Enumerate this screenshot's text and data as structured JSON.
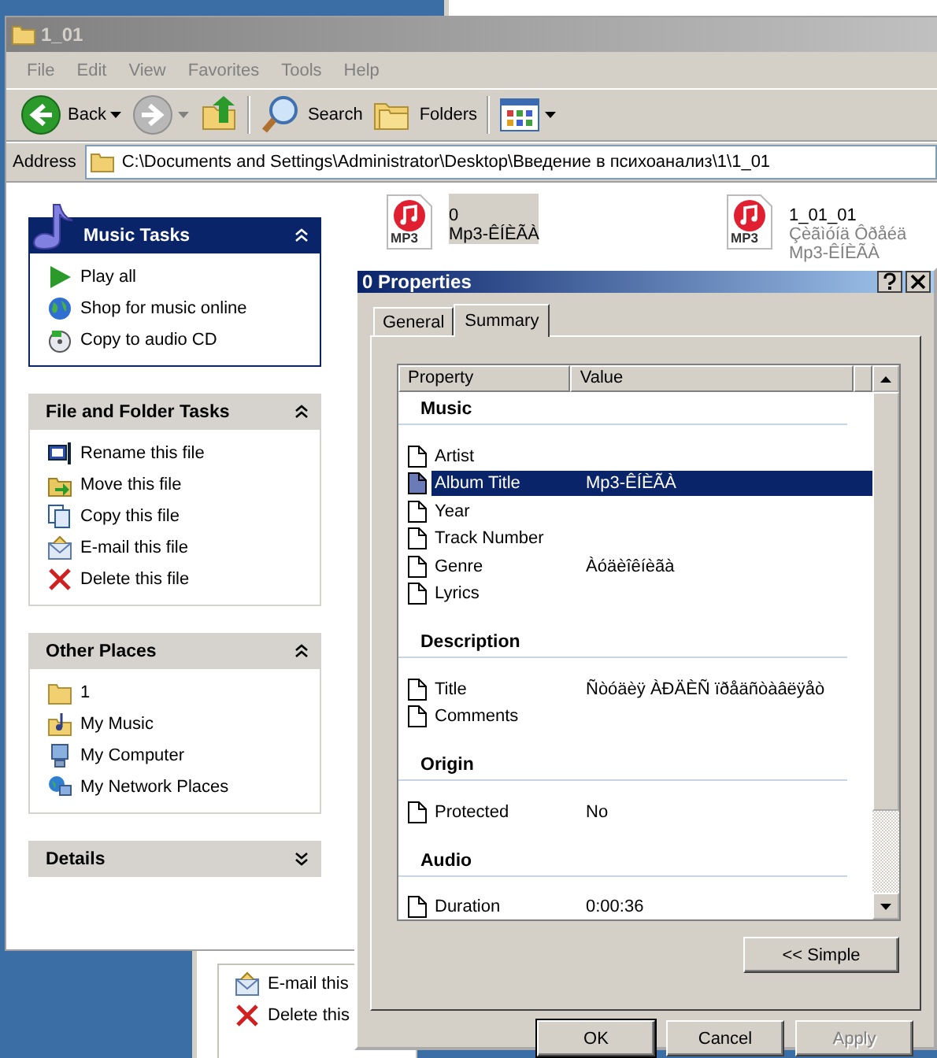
{
  "explorer": {
    "title": "1_01",
    "menu": [
      "File",
      "Edit",
      "View",
      "Favorites",
      "Tools",
      "Help"
    ],
    "toolbar": [
      {
        "kind": "back",
        "label": "Back",
        "dropdown": true
      },
      {
        "kind": "forward",
        "dropdown": true
      },
      {
        "kind": "up"
      },
      {
        "kind": "search",
        "label": "Search"
      },
      {
        "kind": "folders",
        "label": "Folders"
      },
      {
        "kind": "views",
        "dropdown": true
      }
    ],
    "address": {
      "label": "Address",
      "value": "C:\\Documents and Settings\\Administrator\\Desktop\\Введение в психоанализ\\1\\1_01"
    },
    "task_panes": [
      {
        "title": "Music Tasks",
        "kind": "special",
        "expanded": true,
        "items": [
          {
            "kind": "play",
            "label": "Play all"
          },
          {
            "kind": "globe",
            "label": "Shop for music online"
          },
          {
            "kind": "disc",
            "label": "Copy to audio CD"
          }
        ]
      },
      {
        "title": "File and Folder Tasks",
        "kind": "normal",
        "expanded": true,
        "items": [
          {
            "kind": "rename",
            "label": "Rename this file"
          },
          {
            "kind": "move",
            "label": "Move this file"
          },
          {
            "kind": "copy",
            "label": "Copy this file"
          },
          {
            "kind": "email",
            "label": "E-mail this file"
          },
          {
            "kind": "delete",
            "label": "Delete this file"
          }
        ]
      },
      {
        "title": "Other Places",
        "kind": "normal",
        "expanded": true,
        "items": [
          {
            "kind": "folder",
            "label": "1"
          },
          {
            "kind": "music-folder",
            "label": "My Music"
          },
          {
            "kind": "computer",
            "label": "My Computer"
          },
          {
            "kind": "network",
            "label": "My Network Places"
          }
        ]
      },
      {
        "title": "Details",
        "kind": "normal",
        "expanded": false
      }
    ],
    "files": [
      {
        "icon_label": "MP3",
        "name": "0",
        "details": [
          "Mp3-ÊÍÈÃÀ"
        ],
        "selected": true
      },
      {
        "icon_label": "MP3",
        "name": "1_01_01",
        "details": [
          "Çèãìóíä Ôðåéä",
          "Mp3-ÊÍÈÃÀ"
        ],
        "selected": false
      }
    ]
  },
  "dialog": {
    "title": "0 Properties",
    "tabs": [
      {
        "label": "General",
        "selected": false
      },
      {
        "label": "Summary",
        "selected": true
      }
    ],
    "columns": [
      "Property",
      "Value"
    ],
    "rows": [
      {
        "kind": "section",
        "label": "Music"
      },
      {
        "kind": "property",
        "label": "Artist",
        "selected": false
      },
      {
        "kind": "property",
        "label": "Album Title",
        "value": "Mp3-ÊÍÈÃÀ",
        "selected": true
      },
      {
        "kind": "property",
        "label": "Year",
        "selected": false
      },
      {
        "kind": "property",
        "label": "Track Number",
        "selected": false
      },
      {
        "kind": "property",
        "label": "Genre",
        "value": "Àóäèîêíèãà",
        "selected": false
      },
      {
        "kind": "property",
        "label": "Lyrics",
        "selected": false
      },
      {
        "kind": "section",
        "label": "Description"
      },
      {
        "kind": "property",
        "label": "Title",
        "value": "Ñòóäèÿ ÀÐÄÈÑ ïðåäñòàâëÿåò",
        "selected": false
      },
      {
        "kind": "property",
        "label": "Comments",
        "selected": false
      },
      {
        "kind": "section",
        "label": "Origin"
      },
      {
        "kind": "property",
        "label": "Protected",
        "value": "No",
        "selected": false
      },
      {
        "kind": "section",
        "label": "Audio"
      },
      {
        "kind": "property",
        "label": "Duration",
        "value": "0:00:36",
        "selected": false
      }
    ],
    "simple_button": "<< Simple",
    "buttons": [
      {
        "label": "OK",
        "default": true,
        "disabled": false
      },
      {
        "label": "Cancel",
        "default": false,
        "disabled": false
      },
      {
        "label": "Apply",
        "default": false,
        "disabled": true
      }
    ]
  },
  "background_window": {
    "items": [
      {
        "kind": "email",
        "label": "E-mail this"
      },
      {
        "kind": "delete",
        "label": "Delete this"
      }
    ]
  }
}
